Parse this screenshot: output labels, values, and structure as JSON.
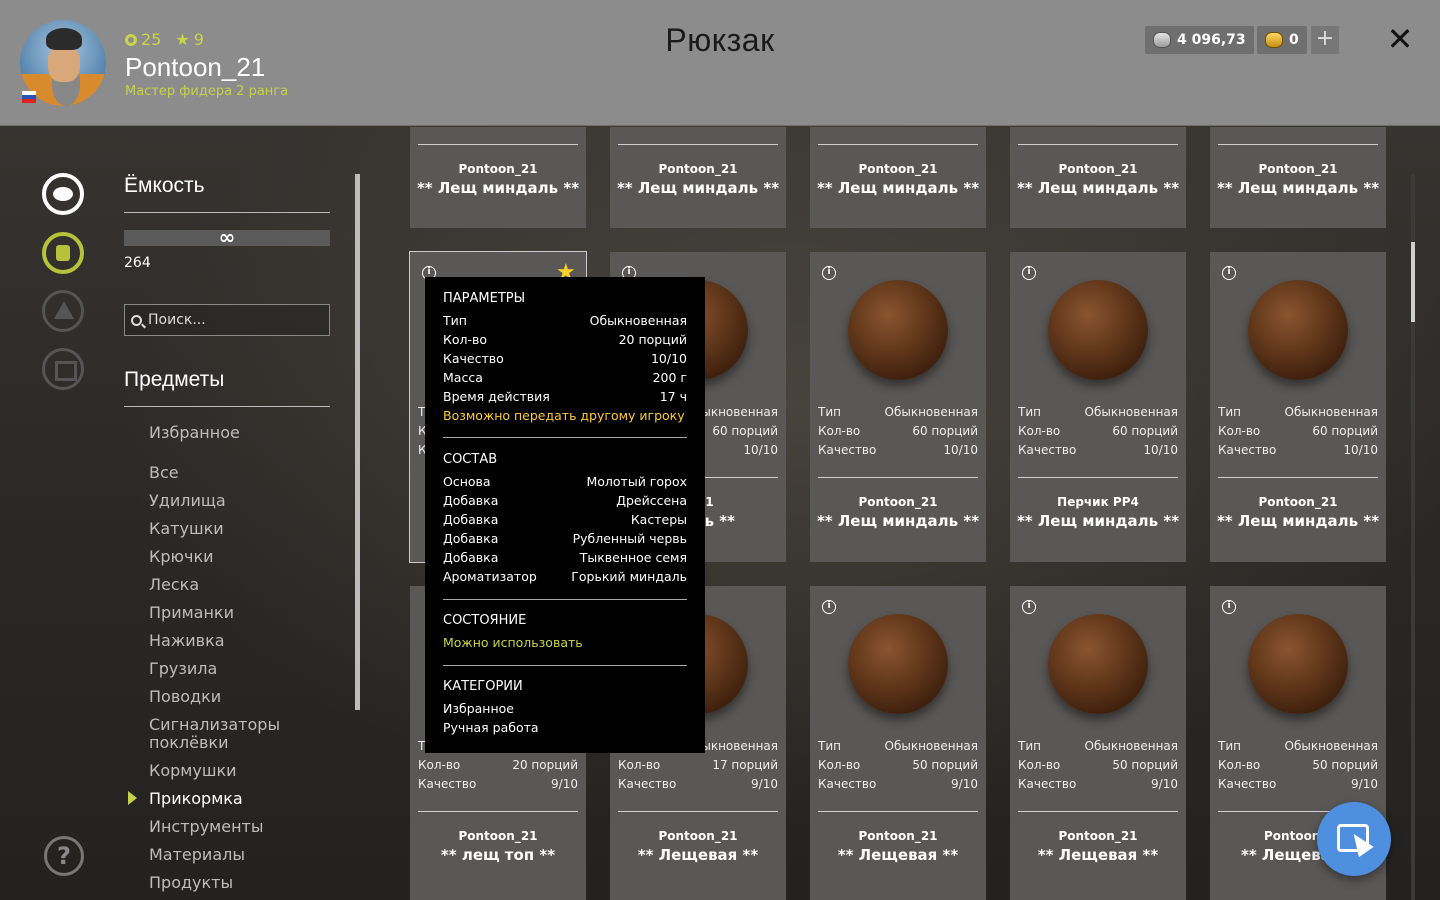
{
  "header": {
    "title": "Рюкзак",
    "player": {
      "level": "25",
      "stars": "9",
      "name": "Pontoon_21",
      "rank": "Мастер фидера 2 ранга"
    },
    "silver": "4 096,73",
    "gold": "0",
    "plus_label": "+",
    "close_label": "✕"
  },
  "sidebar": {
    "capacity_title": "Ёмкость",
    "capacity_value": "∞",
    "capacity_count": "264",
    "search_placeholder": "Поиск...",
    "items_title": "Предметы",
    "categories": [
      "Избранное",
      "Все",
      "Удилища",
      "Катушки",
      "Крючки",
      "Леска",
      "Приманки",
      "Наживка",
      "Грузила",
      "Поводки",
      "Сигнализаторы поклёвки",
      "Кормушки",
      "Прикормка",
      "Инструменты",
      "Материалы",
      "Продукты"
    ],
    "active_category": "Прикормка",
    "help_label": "?"
  },
  "cards_row1": [
    {
      "owner": "Pontoon_21",
      "name": "** Лещ миндаль **"
    },
    {
      "owner": "Pontoon_21",
      "name": "** Лещ миндаль **"
    },
    {
      "owner": "Pontoon_21",
      "name": "** Лещ миндаль **"
    },
    {
      "owner": "Pontoon_21",
      "name": "** Лещ миндаль **"
    },
    {
      "owner": "Pontoon_21",
      "name": "** Лещ миндаль **"
    }
  ],
  "cards_row2": [
    {
      "type_label": "Т",
      "type": "",
      "qty_label": "К",
      "qty": "",
      "quality_label": "К",
      "quality": "",
      "owner": "",
      "name": ""
    },
    {
      "type_label": "",
      "type": "ыкновенная",
      "qty_label": "",
      "qty": "60 порций",
      "quality_label": "",
      "quality": "10/10",
      "owner": "n_21",
      "name": "ндаль **"
    },
    {
      "type_label": "Тип",
      "type": "Обыкновенная",
      "qty_label": "Кол-во",
      "qty": "60 порций",
      "quality_label": "Качество",
      "quality": "10/10",
      "owner": "Pontoon_21",
      "name": "** Лещ миндаль **"
    },
    {
      "type_label": "Тип",
      "type": "Обыкновенная",
      "qty_label": "Кол-во",
      "qty": "60 порций",
      "quality_label": "Качество",
      "quality": "10/10",
      "owner": "Перчик PP4",
      "name": "** Лещ миндаль **"
    },
    {
      "type_label": "Тип",
      "type": "Обыкновенная",
      "qty_label": "Кол-во",
      "qty": "60 порций",
      "quality_label": "Качество",
      "quality": "10/10",
      "owner": "Pontoon_21",
      "name": "** Лещ миндаль **"
    }
  ],
  "cards_row3": [
    {
      "type_label": "Т",
      "type": "",
      "qty_label": "Кол-во",
      "qty": "20 порций",
      "quality_label": "Качество",
      "quality": "9/10",
      "owner": "Pontoon_21",
      "name": "** лещ топ **"
    },
    {
      "type_label": "",
      "type": "ыкновенная",
      "qty_label": "Кол-во",
      "qty": "17 порций",
      "quality_label": "Качество",
      "quality": "9/10",
      "owner": "Pontoon_21",
      "name": "** Лещевая **"
    },
    {
      "type_label": "Тип",
      "type": "Обыкновенная",
      "qty_label": "Кол-во",
      "qty": "50 порций",
      "quality_label": "Качество",
      "quality": "9/10",
      "owner": "Pontoon_21",
      "name": "** Лещевая **"
    },
    {
      "type_label": "Тип",
      "type": "Обыкновенная",
      "qty_label": "Кол-во",
      "qty": "50 порций",
      "quality_label": "Качество",
      "quality": "9/10",
      "owner": "Pontoon_21",
      "name": "** Лещевая **"
    },
    {
      "type_label": "Тип",
      "type": "Обыкновенная",
      "qty_label": "Кол-во",
      "qty": "50 порций",
      "quality_label": "Качество",
      "quality": "9/10",
      "owner": "Pontoon_",
      "name": "** Лещева"
    }
  ],
  "tooltip": {
    "params_title": "ПАРАМЕТРЫ",
    "params": [
      {
        "k": "Тип",
        "v": "Обыкновенная"
      },
      {
        "k": "Кол-во",
        "v": "20 порций"
      },
      {
        "k": "Качество",
        "v": "10/10"
      },
      {
        "k": "Масса",
        "v": "200 г"
      },
      {
        "k": "Время действия",
        "v": "17 ч"
      }
    ],
    "transfer_note": "Возможно передать другому игроку",
    "composition_title": "СОСТАВ",
    "composition": [
      {
        "k": "Основа",
        "v": "Молотый горох"
      },
      {
        "k": "Добавка",
        "v": "Дрейссена"
      },
      {
        "k": "Добавка",
        "v": "Кастеры"
      },
      {
        "k": "Добавка",
        "v": "Рубленный червь"
      },
      {
        "k": "Добавка",
        "v": "Тыквенное семя"
      },
      {
        "k": "Ароматизатор",
        "v": "Горький миндаль"
      }
    ],
    "state_title": "СОСТОЯНИЕ",
    "state_value": "Можно использовать",
    "categories_title": "КАТЕГОРИИ",
    "categories": [
      "Избранное",
      "Ручная работа"
    ]
  },
  "icons": {
    "fish": "fish-icon",
    "backpack": "backpack-icon",
    "tent": "tent-icon",
    "home": "home-icon",
    "info": "info-icon",
    "star": "star-icon",
    "cursor": "cursor-icon"
  },
  "colors": {
    "accent": "#c9d44a",
    "gold_text": "#ffcc33",
    "fab": "#4f8fe0"
  }
}
